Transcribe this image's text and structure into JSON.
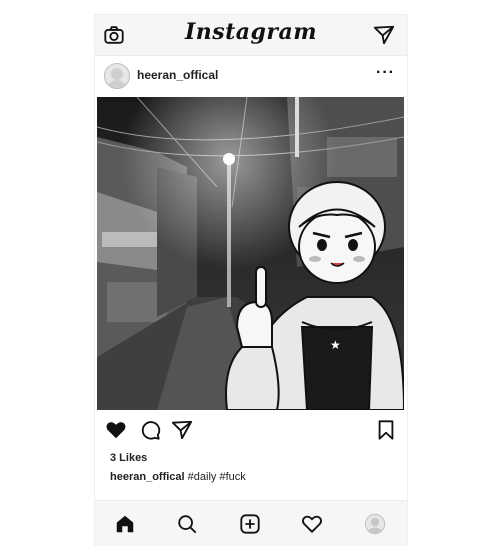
{
  "app": {
    "title": "Instagram"
  },
  "post": {
    "username": "heeran_offical",
    "likes": "3 Likes",
    "caption_user": "heeran_offical",
    "caption_text": "#daily #fuck"
  },
  "icons": {
    "top": [
      "camera-icon",
      "send-icon"
    ],
    "header": [
      "avatar",
      "more-options-icon"
    ],
    "actions": [
      "heart-icon",
      "comment-icon",
      "share-icon",
      "bookmark-icon"
    ],
    "bottom": [
      "home-icon",
      "search-icon",
      "add-post-icon",
      "activity-heart-icon",
      "profile-avatar-icon"
    ]
  },
  "colors": {
    "accent": "#111111",
    "bar_bg": "#f6f6f6"
  },
  "header": {
    "more_label": "···"
  }
}
